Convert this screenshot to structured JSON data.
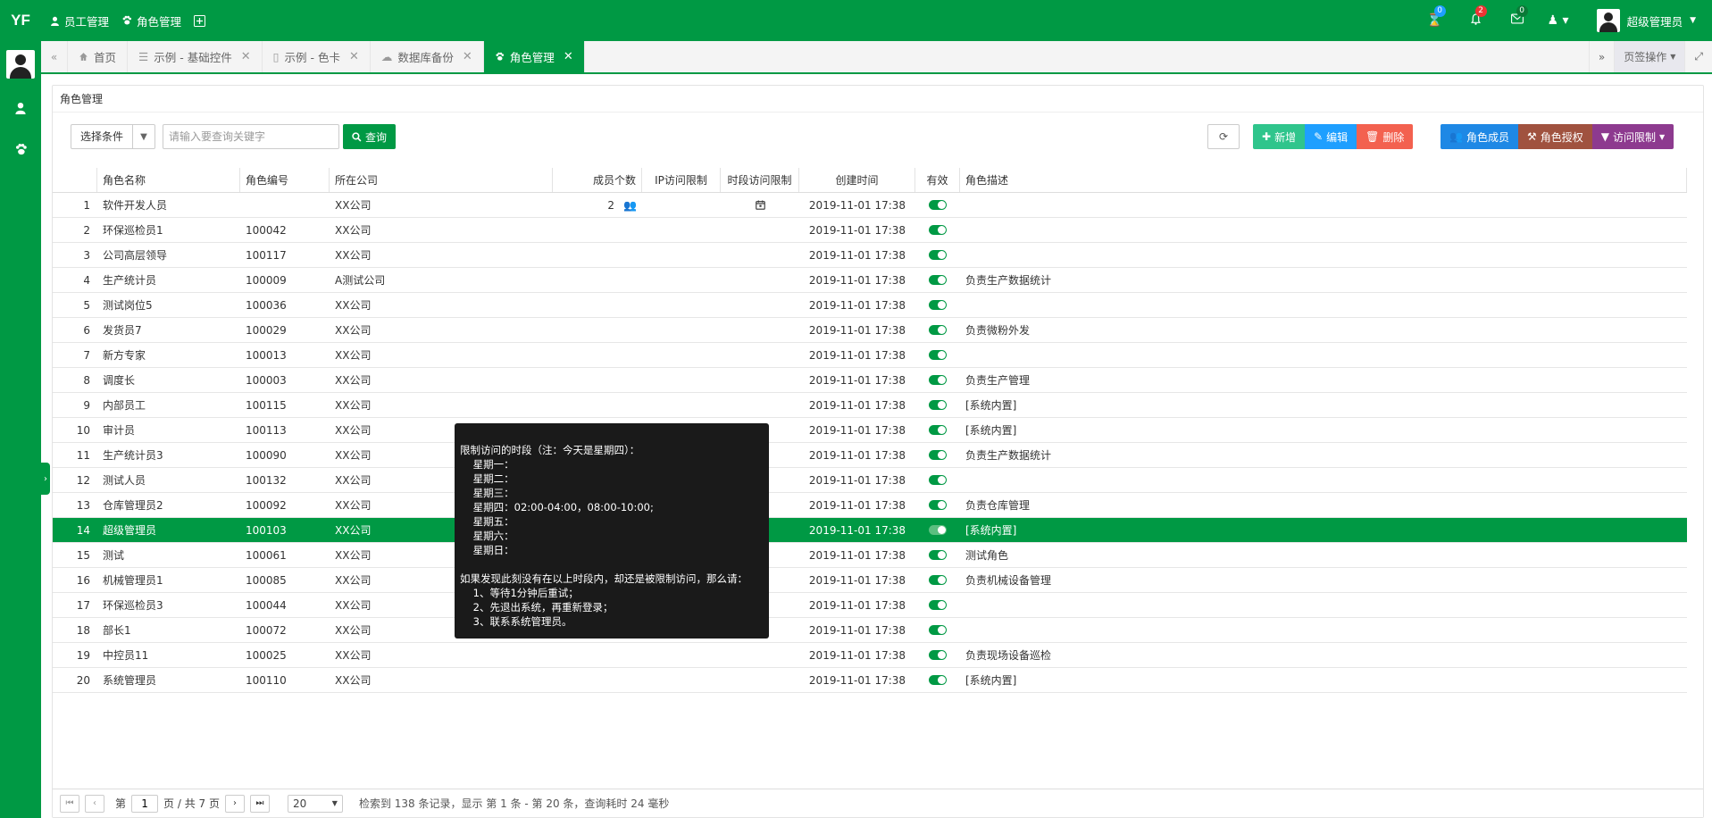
{
  "app": {
    "logo": "YF"
  },
  "topnav": [
    {
      "label": "员工管理"
    },
    {
      "label": "角色管理"
    }
  ],
  "topright": {
    "badges": {
      "hourglass": "0",
      "bell": "2",
      "mail": "0"
    },
    "username": "超级管理员"
  },
  "tabs": [
    {
      "label": "首页",
      "closable": false
    },
    {
      "label": "示例 - 基础控件",
      "closable": true
    },
    {
      "label": "示例 - 色卡",
      "closable": true
    },
    {
      "label": "数据库备份",
      "closable": true
    },
    {
      "label": "角色管理",
      "closable": true,
      "active": true
    }
  ],
  "tab_actions": {
    "page_ops": "页签操作"
  },
  "panel": {
    "title": "角色管理"
  },
  "toolbar": {
    "condition_label": "选择条件",
    "search_placeholder": "请输入要查询关键字",
    "query": "查询",
    "add": "新增",
    "edit": "编辑",
    "delete": "删除",
    "members": "角色成员",
    "authorize": "角色授权",
    "access_limit": "访问限制"
  },
  "table": {
    "headers": [
      "",
      "角色名称",
      "角色编号",
      "所在公司",
      "成员个数",
      "IP访问限制",
      "时段访问限制",
      "创建时间",
      "有效",
      "角色描述"
    ],
    "rows": [
      {
        "no": "1",
        "name": "软件开发人员",
        "code": "",
        "company": "XX公司",
        "members": "2",
        "time_limit": true,
        "created": "2019-11-01 17:38",
        "desc": ""
      },
      {
        "no": "2",
        "name": "环保巡检员1",
        "code": "100042",
        "company": "XX公司",
        "members": "",
        "time_limit": false,
        "created": "2019-11-01 17:38",
        "desc": ""
      },
      {
        "no": "3",
        "name": "公司高层领导",
        "code": "100117",
        "company": "XX公司",
        "members": "",
        "time_limit": false,
        "created": "2019-11-01 17:38",
        "desc": ""
      },
      {
        "no": "4",
        "name": "生产统计员",
        "code": "100009",
        "company": "A测试公司",
        "members": "",
        "time_limit": false,
        "created": "2019-11-01 17:38",
        "desc": "负责生产数据统计"
      },
      {
        "no": "5",
        "name": "测试岗位5",
        "code": "100036",
        "company": "XX公司",
        "members": "",
        "time_limit": false,
        "created": "2019-11-01 17:38",
        "desc": ""
      },
      {
        "no": "6",
        "name": "发货员7",
        "code": "100029",
        "company": "XX公司",
        "members": "",
        "time_limit": false,
        "created": "2019-11-01 17:38",
        "desc": "负责微粉外发"
      },
      {
        "no": "7",
        "name": "新方专家",
        "code": "100013",
        "company": "XX公司",
        "members": "",
        "time_limit": false,
        "created": "2019-11-01 17:38",
        "desc": ""
      },
      {
        "no": "8",
        "name": "调度长",
        "code": "100003",
        "company": "XX公司",
        "members": "",
        "time_limit": false,
        "created": "2019-11-01 17:38",
        "desc": "负责生产管理"
      },
      {
        "no": "9",
        "name": "内部员工",
        "code": "100115",
        "company": "XX公司",
        "members": "",
        "time_limit": false,
        "created": "2019-11-01 17:38",
        "desc": "[系统内置]"
      },
      {
        "no": "10",
        "name": "审计员",
        "code": "100113",
        "company": "XX公司",
        "members": "",
        "time_limit": false,
        "created": "2019-11-01 17:38",
        "desc": "[系统内置]"
      },
      {
        "no": "11",
        "name": "生产统计员3",
        "code": "100090",
        "company": "XX公司",
        "members": "",
        "time_limit": false,
        "created": "2019-11-01 17:38",
        "desc": "负责生产数据统计"
      },
      {
        "no": "12",
        "name": "测试人员",
        "code": "100132",
        "company": "XX公司",
        "members": "",
        "time_limit": false,
        "created": "2019-11-01 17:38",
        "desc": ""
      },
      {
        "no": "13",
        "name": "仓库管理员2",
        "code": "100092",
        "company": "XX公司",
        "members": "",
        "time_limit": false,
        "created": "2019-11-01 17:38",
        "desc": "负责仓库管理"
      },
      {
        "no": "14",
        "name": "超级管理员",
        "code": "100103",
        "company": "XX公司",
        "members": "",
        "time_limit": true,
        "created": "2019-11-01 17:38",
        "desc": "[系统内置]",
        "selected": true
      },
      {
        "no": "15",
        "name": "测试",
        "code": "100061",
        "company": "XX公司",
        "members": "",
        "time_limit": false,
        "created": "2019-11-01 17:38",
        "desc": "测试角色"
      },
      {
        "no": "16",
        "name": "机械管理员1",
        "code": "100085",
        "company": "XX公司",
        "members": "",
        "time_limit": false,
        "created": "2019-11-01 17:38",
        "desc": "负责机械设备管理"
      },
      {
        "no": "17",
        "name": "环保巡检员3",
        "code": "100044",
        "company": "XX公司",
        "members": "",
        "time_limit": false,
        "created": "2019-11-01 17:38",
        "desc": ""
      },
      {
        "no": "18",
        "name": "部长1",
        "code": "100072",
        "company": "XX公司",
        "members": "",
        "time_limit": false,
        "created": "2019-11-01 17:38",
        "desc": ""
      },
      {
        "no": "19",
        "name": "中控员11",
        "code": "100025",
        "company": "XX公司",
        "members": "",
        "time_limit": false,
        "created": "2019-11-01 17:38",
        "desc": "负责现场设备巡检"
      },
      {
        "no": "20",
        "name": "系统管理员",
        "code": "100110",
        "company": "XX公司",
        "members": "",
        "time_limit": false,
        "created": "2019-11-01 17:38",
        "desc": "[系统内置]"
      }
    ]
  },
  "tooltip": {
    "lines": [
      "限制访问的时段（注：今天是星期四）：",
      "    星期一：",
      "    星期二：",
      "    星期三：",
      "    星期四：02:00-04:00，08:00-10:00;",
      "    星期五：",
      "    星期六：",
      "    星期日：",
      "",
      "如果发现此刻没有在以上时段内，却还是被限制访问，那么请：",
      "    1、等待1分钟后重试；",
      "    2、先退出系统，再重新登录；",
      "    3、联系系统管理员。"
    ]
  },
  "pager": {
    "page_prefix": "第",
    "current_page": "1",
    "page_suffix": "页 / 共 7 页",
    "page_size": "20",
    "info": "检索到 138 条记录，显示 第 1 条 - 第 20 条，查询耗时 24 毫秒"
  },
  "colors": {
    "brand": "#009944",
    "add": "#2fc58c",
    "edit": "#1e9fff",
    "delete": "#f3614f",
    "members": "#1e88e5",
    "authorize": "#a0523f",
    "limit": "#8d3a8f"
  }
}
